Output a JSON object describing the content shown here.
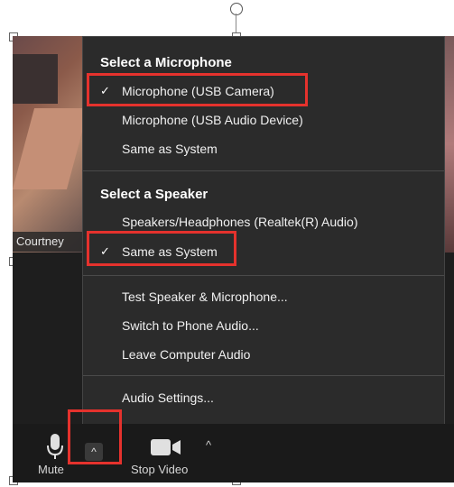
{
  "participant": {
    "name": "Courtney"
  },
  "menu": {
    "microphone_title": "Select a Microphone",
    "microphones": [
      {
        "label": "Microphone (USB Camera)",
        "checked": true
      },
      {
        "label": "Microphone (USB Audio Device)",
        "checked": false
      },
      {
        "label": "Same as System",
        "checked": false
      }
    ],
    "speaker_title": "Select a Speaker",
    "speakers": [
      {
        "label": "Speakers/Headphones (Realtek(R) Audio)",
        "checked": false
      },
      {
        "label": "Same as System",
        "checked": true
      }
    ],
    "actions": [
      {
        "label": "Test Speaker & Microphone..."
      },
      {
        "label": "Switch to Phone Audio..."
      },
      {
        "label": "Leave Computer Audio"
      }
    ],
    "settings_label": "Audio Settings...",
    "check_glyph": "✓"
  },
  "toolbar": {
    "mute_label": "Mute",
    "stop_video_label": "Stop Video",
    "caret_glyph": "^"
  },
  "colors": {
    "highlight": "#e5322d",
    "menu_bg": "#2b2b2b",
    "toolbar_bg": "#1a1a1a"
  }
}
